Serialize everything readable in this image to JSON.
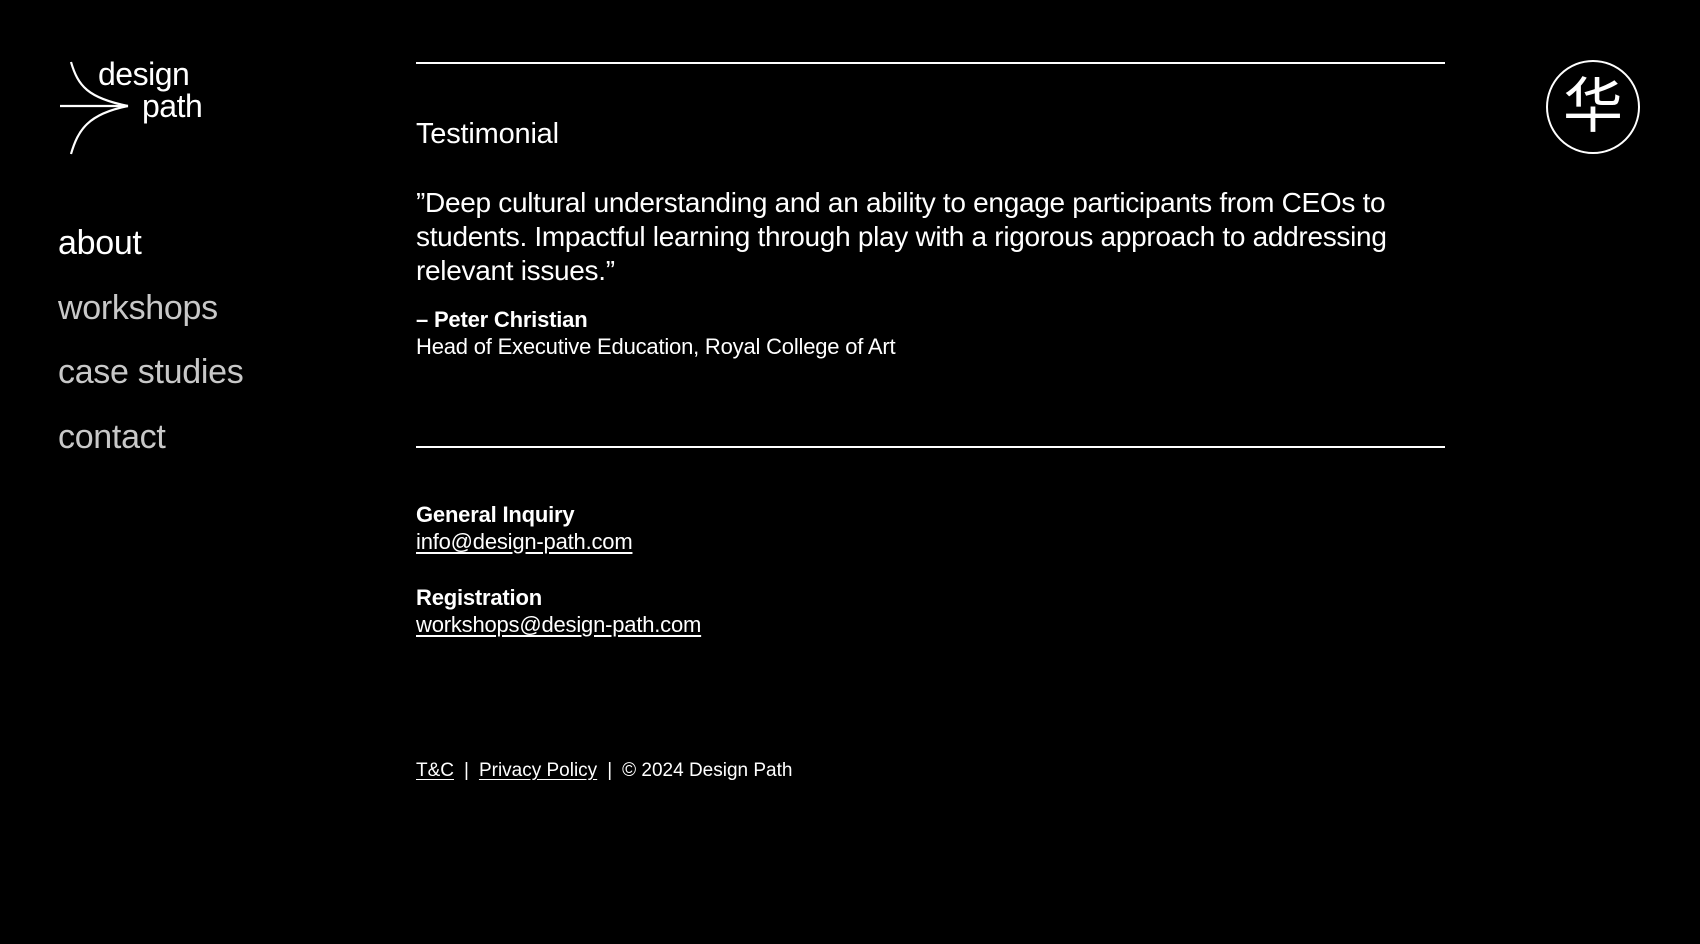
{
  "brand": {
    "logo_line1": "design",
    "logo_line2": "path"
  },
  "nav": {
    "items": [
      {
        "label": "about",
        "active": true
      },
      {
        "label": "workshops",
        "active": false
      },
      {
        "label": "case studies",
        "active": false
      },
      {
        "label": "contact",
        "active": false
      }
    ]
  },
  "badge": {
    "glyph": "华"
  },
  "testimonial": {
    "heading": "Testimonial",
    "quote": "”Deep cultural understanding and an ability to engage participants from CEOs to students. Impactful learning through play with a rigorous approach to addressing relevant issues.”",
    "author": "– Peter Christian",
    "role": "Head of Executive Education, Royal College of Art"
  },
  "contact": {
    "general_label": "General Inquiry",
    "general_email": "info@design-path.com",
    "registration_label": "Registration",
    "registration_email": "workshops@design-path.com"
  },
  "footer": {
    "tc": "T&C",
    "separator": "|",
    "privacy": "Privacy Policy",
    "copyright": "© 2024 Design Path"
  },
  "colors": {
    "background": "#000000",
    "text": "#ffffff",
    "nav_inactive": "#c8c8c8"
  }
}
